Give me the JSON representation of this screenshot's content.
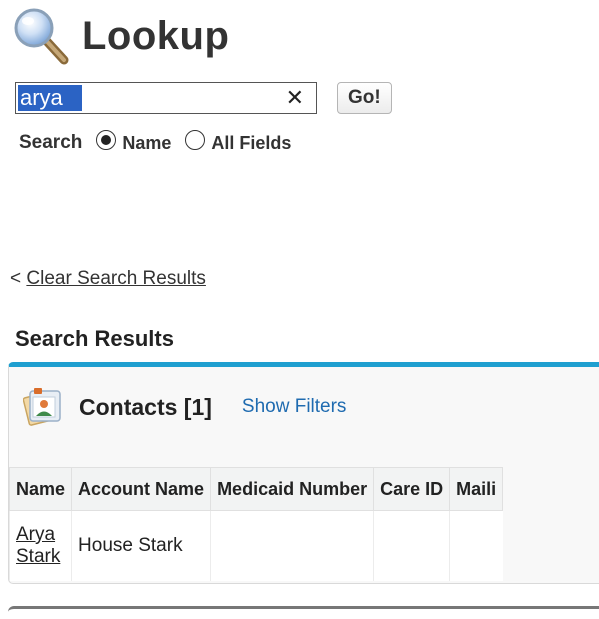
{
  "header": {
    "title": "Lookup",
    "icon": "magnifier-icon"
  },
  "search": {
    "value": "arya",
    "clear_symbol": "✕",
    "go_label": "Go!"
  },
  "search_options": {
    "label": "Search",
    "options": [
      {
        "label": "Name",
        "checked": true
      },
      {
        "label": "All Fields",
        "checked": false
      }
    ]
  },
  "clear_results": {
    "prefix": "<",
    "label": "Clear Search Results"
  },
  "results": {
    "heading": "Search Results",
    "panel": {
      "title": "Contacts [1]",
      "show_filters": "Show Filters",
      "icon": "contacts-icon",
      "accent_color": "#1f9fd0",
      "columns": [
        "Name",
        "Account Name",
        "Medicaid Number",
        "Care ID",
        "Maili"
      ],
      "rows": [
        {
          "name": "Arya Stark",
          "name_line1": "Arya",
          "name_line2": "Stark",
          "account": "House Stark",
          "medicaid": "",
          "care_id": "",
          "mailing": ""
        }
      ]
    }
  }
}
